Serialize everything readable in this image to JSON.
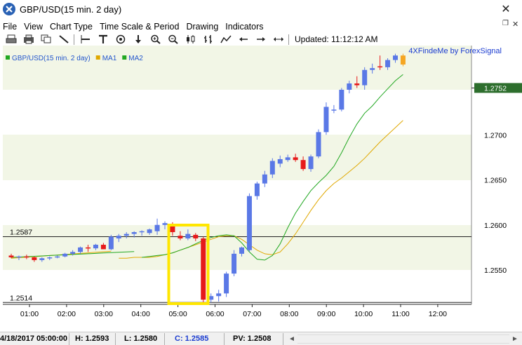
{
  "window": {
    "title": "GBP/USD(15 min. 2 day)",
    "close_glyph": "✕"
  },
  "menu": {
    "items": [
      "File",
      "View",
      "Chart Type",
      "Time Scale & Period",
      "Drawing",
      "Indicators"
    ],
    "restore_glyph": "❐",
    "close_glyph": "✕"
  },
  "toolbar": {
    "icons": [
      "print-icon",
      "printer-icon",
      "copy-window-icon",
      "trend-line-icon",
      "horizontal-line-icon",
      "text-tool-icon",
      "circle-target-icon",
      "down-arrow-icon",
      "zoom-in-icon",
      "zoom-out-icon",
      "candlestick-icon",
      "bar-chart-icon",
      "line-chart-icon",
      "scroll-left-icon",
      "scroll-right-icon",
      "fit-width-icon"
    ],
    "updated_text": "Updated: 11:12:12 AM"
  },
  "chart": {
    "watermark": "4XFindeMe by ForexSignal",
    "legend": [
      {
        "label": "GBP/USD(15 min.  2 day)",
        "color": "#22a822"
      },
      {
        "label": "MA1",
        "color": "#e0a800"
      },
      {
        "label": "MA2",
        "color": "#22a822"
      }
    ],
    "hline_labels": {
      "upper": "1.2587",
      "lower": "1.2514"
    },
    "current_price": "1.2752",
    "colors": {
      "up": "#5a78e6",
      "down": "#e61a1a",
      "last": "#f5a623",
      "ma1": "#e0a800",
      "ma2": "#22a822",
      "band": "#f2f6e6",
      "price_box": "#2d6e2d",
      "highlight": "#ffe600"
    }
  },
  "chart_data": {
    "type": "candlestick",
    "title": "GBP/USD(15 min. 2 day)",
    "y_ticks": [
      "1.2750",
      "1.2700",
      "1.2650",
      "1.2600",
      "1.2550"
    ],
    "x_ticks": [
      "01:00",
      "02:00",
      "03:00",
      "04:00",
      "05:00",
      "06:00",
      "07:00",
      "08:00",
      "09:00",
      "10:00",
      "11:00",
      "12:00"
    ],
    "hlines": [
      1.2587,
      1.2514
    ],
    "candles": [
      {
        "o": 1.2566,
        "h": 1.2568,
        "l": 1.2563,
        "c": 1.2564
      },
      {
        "o": 1.2564,
        "h": 1.2566,
        "l": 1.2561,
        "c": 1.2565
      },
      {
        "o": 1.2565,
        "h": 1.2567,
        "l": 1.2562,
        "c": 1.2564
      },
      {
        "o": 1.2564,
        "h": 1.2565,
        "l": 1.2559,
        "c": 1.2561
      },
      {
        "o": 1.2561,
        "h": 1.2564,
        "l": 1.2559,
        "c": 1.2563
      },
      {
        "o": 1.2563,
        "h": 1.2565,
        "l": 1.2561,
        "c": 1.2564
      },
      {
        "o": 1.2564,
        "h": 1.2566,
        "l": 1.2563,
        "c": 1.2565
      },
      {
        "o": 1.2565,
        "h": 1.2569,
        "l": 1.2564,
        "c": 1.2568
      },
      {
        "o": 1.2568,
        "h": 1.2572,
        "l": 1.2566,
        "c": 1.257
      },
      {
        "o": 1.257,
        "h": 1.2576,
        "l": 1.2568,
        "c": 1.2575
      },
      {
        "o": 1.2575,
        "h": 1.2578,
        "l": 1.257,
        "c": 1.2574
      },
      {
        "o": 1.2574,
        "h": 1.2579,
        "l": 1.2572,
        "c": 1.2578
      },
      {
        "o": 1.2578,
        "h": 1.258,
        "l": 1.2573,
        "c": 1.2573
      },
      {
        "o": 1.2573,
        "h": 1.2589,
        "l": 1.2572,
        "c": 1.2587
      },
      {
        "o": 1.2585,
        "h": 1.259,
        "l": 1.2581,
        "c": 1.2588
      },
      {
        "o": 1.2588,
        "h": 1.2592,
        "l": 1.2585,
        "c": 1.259
      },
      {
        "o": 1.259,
        "h": 1.2593,
        "l": 1.2586,
        "c": 1.2592
      },
      {
        "o": 1.2592,
        "h": 1.2594,
        "l": 1.2588,
        "c": 1.2593
      },
      {
        "o": 1.2591,
        "h": 1.2596,
        "l": 1.2589,
        "c": 1.2595
      },
      {
        "o": 1.2593,
        "h": 1.2607,
        "l": 1.2589,
        "c": 1.26
      },
      {
        "o": 1.26,
        "h": 1.2604,
        "l": 1.2595,
        "c": 1.2602
      },
      {
        "o": 1.26,
        "h": 1.2603,
        "l": 1.2588,
        "c": 1.2592
      },
      {
        "o": 1.2588,
        "h": 1.2593,
        "l": 1.2583,
        "c": 1.2585
      },
      {
        "o": 1.2585,
        "h": 1.2595,
        "l": 1.2583,
        "c": 1.259
      },
      {
        "o": 1.2589,
        "h": 1.2591,
        "l": 1.2582,
        "c": 1.2585
      },
      {
        "o": 1.2585,
        "h": 1.2587,
        "l": 1.2514,
        "c": 1.2517
      },
      {
        "o": 1.2517,
        "h": 1.2524,
        "l": 1.2514,
        "c": 1.2521
      },
      {
        "o": 1.2521,
        "h": 1.2528,
        "l": 1.2515,
        "c": 1.2524
      },
      {
        "o": 1.2524,
        "h": 1.2548,
        "l": 1.252,
        "c": 1.2546
      },
      {
        "o": 1.2546,
        "h": 1.2572,
        "l": 1.2543,
        "c": 1.2568
      },
      {
        "o": 1.2568,
        "h": 1.2576,
        "l": 1.2565,
        "c": 1.2575
      },
      {
        "o": 1.2572,
        "h": 1.2635,
        "l": 1.257,
        "c": 1.2632
      },
      {
        "o": 1.2632,
        "h": 1.2648,
        "l": 1.2628,
        "c": 1.2646
      },
      {
        "o": 1.2646,
        "h": 1.266,
        "l": 1.2642,
        "c": 1.2656
      },
      {
        "o": 1.2656,
        "h": 1.2674,
        "l": 1.2652,
        "c": 1.2671
      },
      {
        "o": 1.2668,
        "h": 1.2677,
        "l": 1.2664,
        "c": 1.2673
      },
      {
        "o": 1.2672,
        "h": 1.2678,
        "l": 1.267,
        "c": 1.2675
      },
      {
        "o": 1.2675,
        "h": 1.2679,
        "l": 1.267,
        "c": 1.2672
      },
      {
        "o": 1.2672,
        "h": 1.2676,
        "l": 1.266,
        "c": 1.2662
      },
      {
        "o": 1.2662,
        "h": 1.2678,
        "l": 1.2659,
        "c": 1.2676
      },
      {
        "o": 1.2676,
        "h": 1.2706,
        "l": 1.2674,
        "c": 1.2703
      },
      {
        "o": 1.2703,
        "h": 1.2736,
        "l": 1.27,
        "c": 1.2731
      },
      {
        "o": 1.2728,
        "h": 1.2733,
        "l": 1.2724,
        "c": 1.2728
      },
      {
        "o": 1.2728,
        "h": 1.2752,
        "l": 1.2726,
        "c": 1.275
      },
      {
        "o": 1.275,
        "h": 1.276,
        "l": 1.2746,
        "c": 1.2757
      },
      {
        "o": 1.2757,
        "h": 1.2765,
        "l": 1.2752,
        "c": 1.2755
      },
      {
        "o": 1.2755,
        "h": 1.2775,
        "l": 1.275,
        "c": 1.2772
      },
      {
        "o": 1.2772,
        "h": 1.2779,
        "l": 1.2768,
        "c": 1.2774
      },
      {
        "o": 1.2776,
        "h": 1.2788,
        "l": 1.2772,
        "c": 1.2775
      },
      {
        "o": 1.2775,
        "h": 1.2785,
        "l": 1.2772,
        "c": 1.2783
      },
      {
        "o": 1.2783,
        "h": 1.279,
        "l": 1.278,
        "c": 1.2788
      },
      {
        "o": 1.2788,
        "h": 1.279,
        "l": 1.2776,
        "c": 1.2778
      }
    ],
    "ma1": [
      1.2563,
      1.2563,
      1.2564,
      1.2564,
      1.2564,
      1.2565,
      1.2567,
      1.2569,
      1.2572,
      1.2575,
      1.2578,
      1.2581,
      1.2584,
      1.2587,
      1.2588,
      1.2588,
      1.2584,
      1.2578,
      1.2572,
      1.2568,
      1.2567,
      1.257,
      1.2579,
      1.259,
      1.2603,
      1.2616,
      1.2628,
      1.2638,
      1.2646,
      1.2652,
      1.2659,
      1.2666,
      1.2674,
      1.2683,
      1.2692,
      1.27,
      1.2708,
      1.2716
    ],
    "ma1_start": 14,
    "ma2": [
      1.2564,
      1.2565,
      1.2566,
      1.2567,
      1.2569,
      1.2572,
      1.2575,
      1.2579,
      1.2583,
      1.2586,
      1.2588,
      1.2589,
      1.2588,
      1.258,
      1.257,
      1.2562,
      1.2561,
      1.2566,
      1.2579,
      1.2597,
      1.2613,
      1.2626,
      1.2638,
      1.2647,
      1.2655,
      1.2665,
      1.268,
      1.2697,
      1.2712,
      1.2724,
      1.2732,
      1.2742,
      1.2751,
      1.276,
      1.2767
    ],
    "ma2_start": 17
  },
  "status": {
    "datetime": "4/18/2017 05:00:00",
    "high": "H: 1.2593",
    "low": "L: 1.2580",
    "close": "C: 1.2585",
    "pv": "PV: 1.2508",
    "scroll_left": "◄",
    "scroll_right": "►"
  }
}
